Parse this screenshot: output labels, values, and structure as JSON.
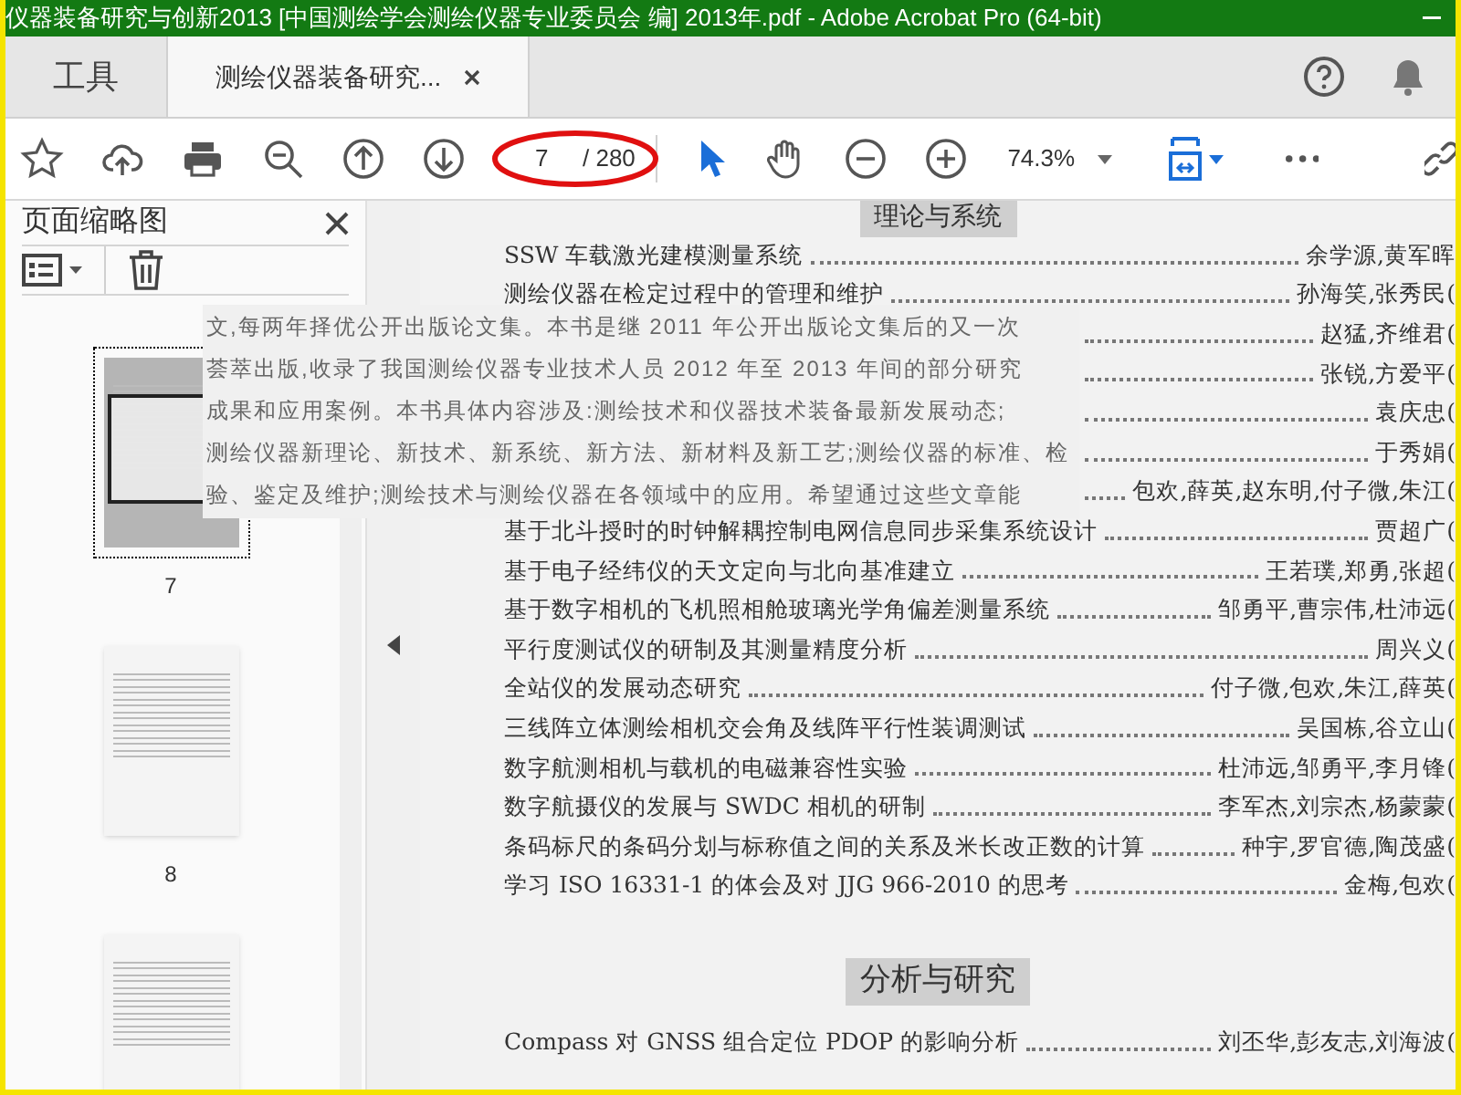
{
  "window": {
    "title": "仪器装备研究与创新2013 [中国测绘学会测绘仪器专业委员会 编] 2013年.pdf - Adobe Acrobat Pro (64-bit)"
  },
  "tabs": [
    {
      "label": "工具",
      "selected": false
    },
    {
      "label": "测绘仪器装备研究...",
      "selected": true
    }
  ],
  "toolbar": {
    "page_current": "7",
    "page_total": "/ 280",
    "zoom": "74.3%"
  },
  "thumbnails_panel": {
    "title": "页面缩略图",
    "pages": [
      {
        "label": "7",
        "selected": true
      },
      {
        "label": "8",
        "selected": false
      },
      {
        "selected": false
      }
    ]
  },
  "document": {
    "sections": [
      {
        "heading": "理论与系统",
        "entries": [
          {
            "title": "SSW 车载激光建模测量系统",
            "authors": "余学源,黄军晖"
          },
          {
            "title": "测绘仪器在检定过程中的管理和维护",
            "authors": "孙海笑,张秀民("
          },
          {
            "authors": "赵猛,齐维君("
          },
          {
            "authors": "张锐,方爱平("
          },
          {
            "authors": "袁庆忠("
          },
          {
            "authors": "于秀娟("
          },
          {
            "authors": "包欢,薛英,赵东明,付子微,朱江("
          },
          {
            "title": "基于北斗授时的时钟解耦控制电网信息同步采集系统设计",
            "authors": "贾超广("
          },
          {
            "title": "基于电子经纬仪的天文定向与北向基准建立",
            "authors": "王若璞,郑勇,张超("
          },
          {
            "title": "基于数字相机的飞机照相舱玻璃光学角偏差测量系统",
            "authors": "邹勇平,曹宗伟,杜沛远("
          },
          {
            "title": "平行度测试仪的研制及其测量精度分析",
            "authors": "周兴义("
          },
          {
            "title": "全站仪的发展动态研究",
            "authors": "付子微,包欢,朱江,薛英("
          },
          {
            "title": "三线阵立体测绘相机交会角及线阵平行性装调测试",
            "authors": "吴国栋,谷立山("
          },
          {
            "title": "数字航测相机与载机的电磁兼容性实验",
            "authors": "杜沛远,邹勇平,李月锋("
          },
          {
            "title": "数字航摄仪的发展与 SWDC 相机的研制",
            "authors": "李军杰,刘宗杰,杨蒙蒙("
          },
          {
            "title": "条码标尺的条码分划与标称值之间的关系及米长改正数的计算",
            "authors": "种宇,罗官德,陶茂盛("
          },
          {
            "title": "学习 ISO 16331-1 的体会及对 JJG 966-2010 的思考",
            "authors": "金梅,包欢("
          }
        ]
      },
      {
        "heading": "分析与研究",
        "entries": [
          {
            "title": "Compass 对 GNSS 组合定位 PDOP 的影响分析",
            "authors": "刘丕华,彭友志,刘海波("
          }
        ]
      }
    ]
  },
  "overlay_text": {
    "lines": [
      "文,每两年择优公开出版论文集。本书是继 2011 年公开出版论文集后的又一次",
      "荟萃出版,收录了我国测绘仪器专业技术人员 2012 年至 2013 年间的部分研究",
      "成果和应用案例。本书具体内容涉及:测绘技术和仪器技术装备最新发展动态;",
      "测绘仪器新理论、新技术、新系统、新方法、新材料及新工艺;测绘仪器的标准、检",
      "验、鉴定及维护;测绘技术与测绘仪器在各领域中的应用。希望通过这些文章能"
    ]
  }
}
